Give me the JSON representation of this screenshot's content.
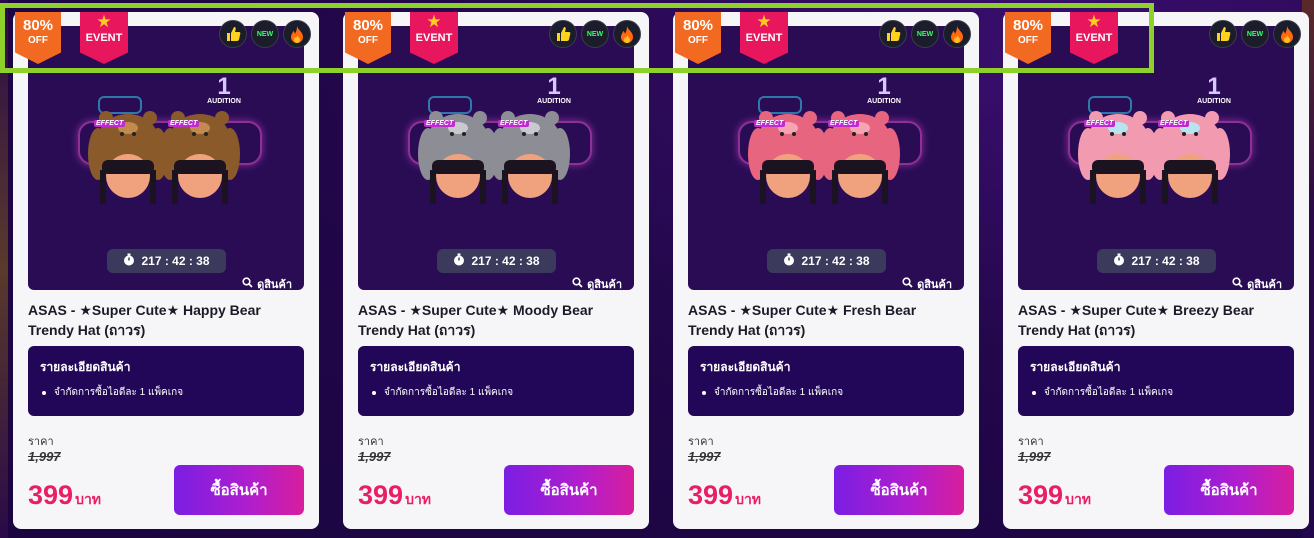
{
  "colors": {
    "page_bg": "#22074a",
    "card_bg": "#f6f6f8",
    "off_badge": "#f26a21",
    "event_badge": "#e8175d",
    "price": "#e91e63",
    "button_from": "#7b1ee3",
    "button_to": "#d81e9c",
    "highlight": "#8ed12b"
  },
  "products": [
    {
      "discount_pct": "80%",
      "discount_off": "OFF",
      "event_label": "EVENT",
      "icons": [
        "thumbs-up-icon",
        "new-icon",
        "fire-icon"
      ],
      "new_label": "NEW",
      "effect_label": "EFFECT",
      "timer": "217 : 42 : 38",
      "view_label": "ดูสินค้า",
      "title": "ASAS - ★Super Cute★ Happy Bear Trendy Hat (ถาวร)",
      "details_heading": "รายละเอียดสินค้า",
      "details_items": [
        "จำกัดการซื้อไอดีละ 1 แพ็คเกจ"
      ],
      "price_label": "ราคา",
      "old_price": "1,997",
      "new_price": "399",
      "currency": "บาท",
      "buy_label": "ซื้อสินค้า",
      "hat_color": "#8a5a2b",
      "hat_accent": "#c28a4f"
    },
    {
      "discount_pct": "80%",
      "discount_off": "OFF",
      "event_label": "EVENT",
      "icons": [
        "thumbs-up-icon",
        "new-icon",
        "fire-icon"
      ],
      "new_label": "NEW",
      "effect_label": "EFFECT",
      "timer": "217 : 42 : 38",
      "view_label": "ดูสินค้า",
      "title": "ASAS - ★Super Cute★ Moody Bear Trendy Hat (ถาวร)",
      "details_heading": "รายละเอียดสินค้า",
      "details_items": [
        "จำกัดการซื้อไอดีละ 1 แพ็คเกจ"
      ],
      "price_label": "ราคา",
      "old_price": "1,997",
      "new_price": "399",
      "currency": "บาท",
      "buy_label": "ซื้อสินค้า",
      "hat_color": "#8d8d95",
      "hat_accent": "#c9c9cf"
    },
    {
      "discount_pct": "80%",
      "discount_off": "OFF",
      "event_label": "EVENT",
      "icons": [
        "thumbs-up-icon",
        "new-icon",
        "fire-icon"
      ],
      "new_label": "NEW",
      "effect_label": "EFFECT",
      "timer": "217 : 42 : 38",
      "view_label": "ดูสินค้า",
      "title": "ASAS - ★Super Cute★ Fresh Bear Trendy Hat (ถาวร)",
      "details_heading": "รายละเอียดสินค้า",
      "details_items": [
        "จำกัดการซื้อไอดีละ 1 แพ็คเกจ"
      ],
      "price_label": "ราคา",
      "old_price": "1,997",
      "new_price": "399",
      "currency": "บาท",
      "buy_label": "ซื้อสินค้า",
      "hat_color": "#e8657f",
      "hat_accent": "#f6a3b3"
    },
    {
      "discount_pct": "80%",
      "discount_off": "OFF",
      "event_label": "EVENT",
      "icons": [
        "thumbs-up-icon",
        "new-icon",
        "fire-icon"
      ],
      "new_label": "NEW",
      "effect_label": "EFFECT",
      "timer": "217 : 42 : 38",
      "view_label": "ดูสินค้า",
      "title": "ASAS - ★Super Cute★ Breezy Bear Trendy Hat (ถาวร)",
      "details_heading": "รายละเอียดสินค้า",
      "details_items": [
        "จำกัดการซื้อไอดีละ 1 แพ็คเกจ"
      ],
      "price_label": "ราคา",
      "old_price": "1,997",
      "new_price": "399",
      "currency": "บาท",
      "buy_label": "ซื้อสินค้า",
      "hat_color": "#f29ab0",
      "hat_accent": "#b8e4f0"
    }
  ]
}
